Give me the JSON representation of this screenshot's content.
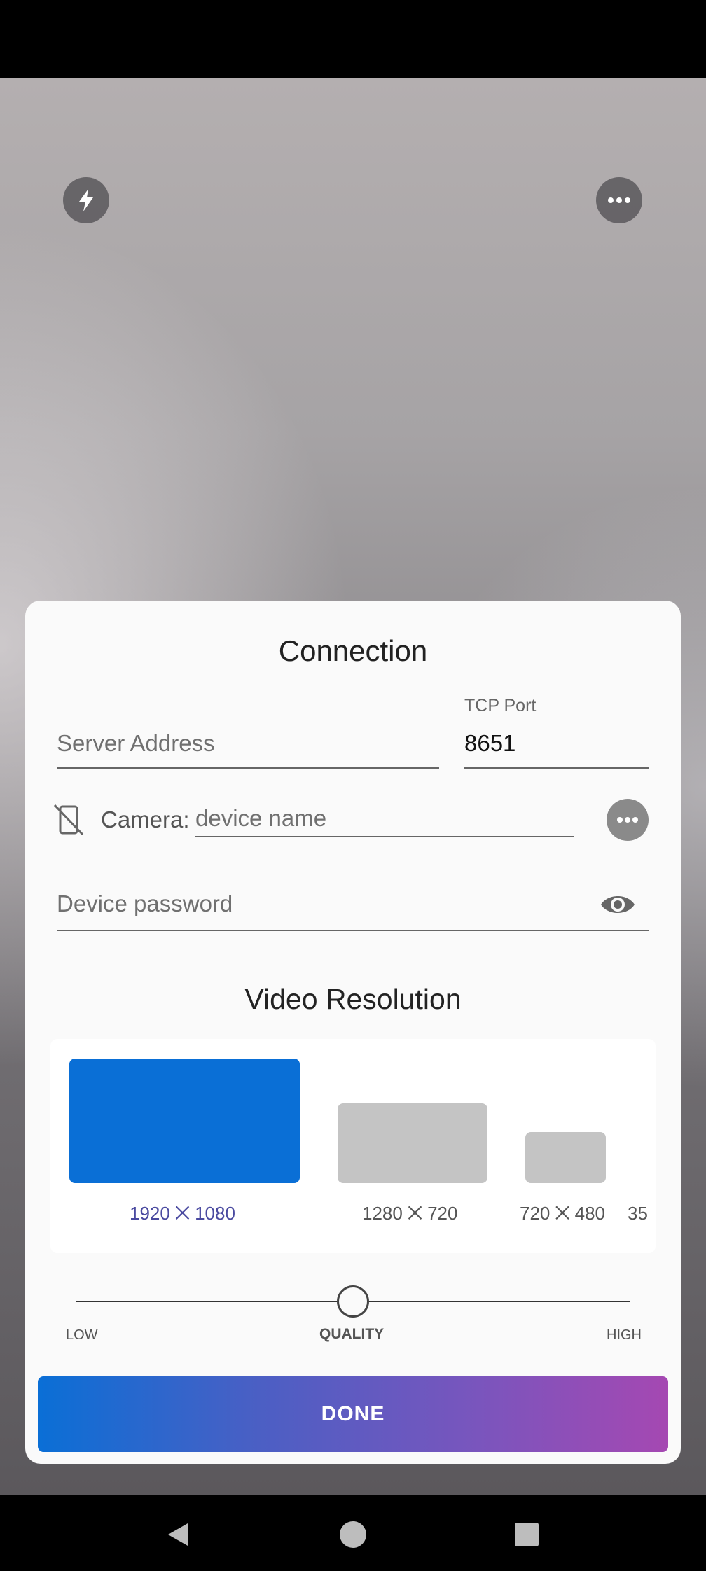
{
  "dialog": {
    "connection_title": "Connection",
    "server_address_placeholder": "Server Address",
    "tcp_port_label": "TCP Port",
    "tcp_port_value": "8651",
    "camera_label": "Camera:",
    "device_name_placeholder": "device name",
    "password_placeholder": "Device password",
    "video_title": "Video Resolution",
    "resolutions": [
      {
        "label": "1920 ⨉ 1080",
        "selected": true
      },
      {
        "label": "1280 ⨉ 720",
        "selected": false
      },
      {
        "label": "720 ⨉ 480",
        "selected": false
      },
      {
        "label": "35",
        "selected": false
      }
    ],
    "quality": {
      "low_label": "LOW",
      "center_label": "QUALITY",
      "high_label": "HIGH",
      "level": 0.5
    },
    "done_label": "DONE"
  },
  "colors": {
    "selected_resolution": "#0a6fd6",
    "unselected_resolution": "#c4c4c4",
    "done_gradient_start": "#0a6fd6",
    "done_gradient_end": "#a548b2"
  },
  "icons": {
    "top_left": "flash-icon",
    "top_right": "more-icon",
    "camera": "no-camera-icon",
    "camera_more": "more-icon",
    "password": "visibility-icon",
    "nav": [
      "back-icon",
      "home-icon",
      "recents-icon"
    ]
  }
}
